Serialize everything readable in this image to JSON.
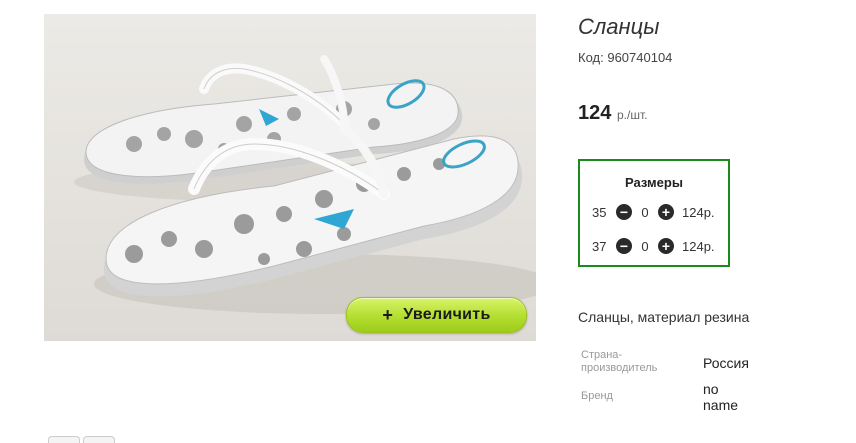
{
  "product": {
    "title": "Сланцы",
    "code_label": "Код:",
    "code_value": "960740104",
    "price_value": "124",
    "price_unit": "р./шт."
  },
  "zoom_button": {
    "icon": "plus-icon",
    "label": "Увеличить"
  },
  "sizes": {
    "title": "Размеры",
    "rows": [
      {
        "size": "35",
        "qty": "0",
        "price": "124р."
      },
      {
        "size": "37",
        "qty": "0",
        "price": "124р."
      }
    ]
  },
  "description": "Сланцы, материал резина",
  "specs": [
    {
      "label_line1": "Страна-",
      "label_line2": "производитель",
      "value": "Россия"
    },
    {
      "label_line1": "Бренд",
      "value_line1": "no",
      "value_line2": "name"
    }
  ],
  "colors": {
    "box_border": "#1a8a1a",
    "zoom_button": "#b6e033"
  }
}
